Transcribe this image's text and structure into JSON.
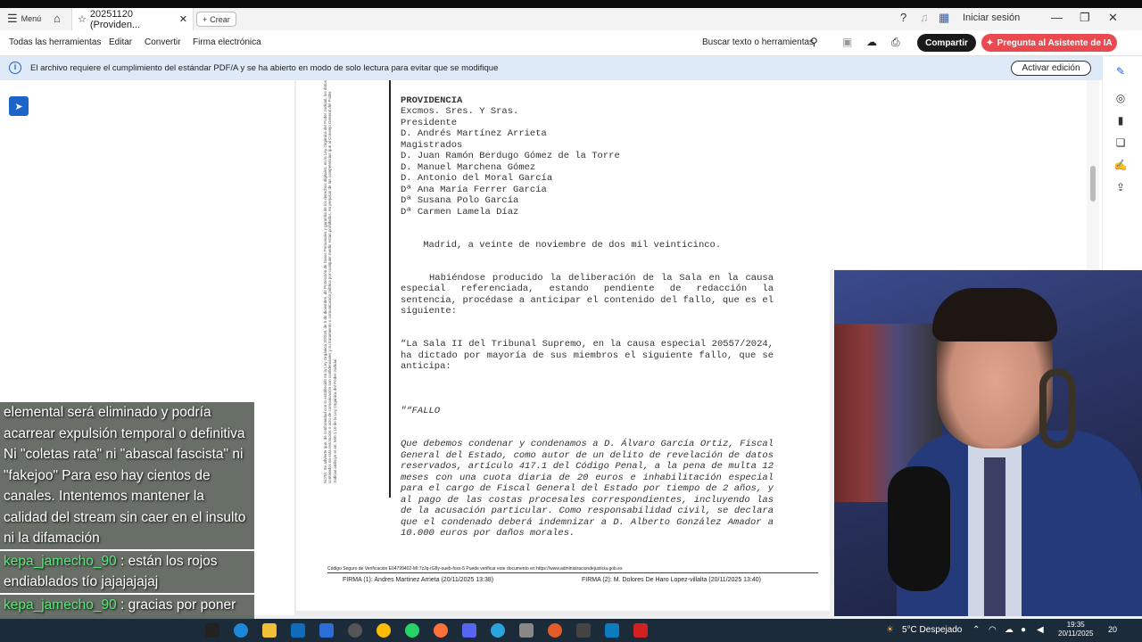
{
  "titlebar": {
    "menu_label": "Menú",
    "tab_title": "20251120 (Providen...",
    "new_tab_label": "Crear",
    "signin_label": "Iniciar sesión"
  },
  "toolbar": {
    "all_tools": "Todas las herramientas",
    "edit": "Editar",
    "convert": "Convertir",
    "esign": "Firma electrónica",
    "search": "Buscar texto o herramientas",
    "share": "Compartir",
    "ai_assistant": "Pregunta al Asistente de IA"
  },
  "banner": {
    "message": "El archivo requiere el cumplimiento del estándar PDF/A y se ha abierto en modo de solo lectura para evitar que se modifique",
    "enable_edit": "Activar edición"
  },
  "document": {
    "side_note": "NOTA: Se advierte que, de conformidad con lo establecido en la Ley Orgánica 3/2018, de 5 de diciembre, de Protección de Datos Personales y garantía de los derechos digitales, en la Ley Orgánica del Poder Judicial, los datos contenidos en esta resolución o acto de comunicación son confidenciales y su tratamiento o comunicación pública por cualquier medio están prohibidos, en perjuicio de las competencias que al Consejo General del Poder Judicial atribuye el art. 560.1.10 de la Ley Orgánica del Poder Judicial",
    "header_lines": [
      "PROVIDENCIA",
      "Excmos. Sres. Y Sras.",
      "Presidente",
      "D. Andrés Martínez Arrieta",
      "Magistrados",
      "D. Juan Ramón Berdugo Gómez de la Torre",
      "D. Manuel Marchena Gómez",
      "D. Antonio del Moral García",
      "Dª Ana María Ferrer García",
      "Dª Susana Polo García",
      "Dª Carmen Lamela Díaz"
    ],
    "place_date": "    Madrid, a veinte de noviembre de dos mil veinticinco.",
    "para1": "Habiéndose producido la deliberación de la Sala en la causa especial referenciada, estando pendiente de redacción la sentencia, procédase a anticipar el contenido del fallo, que es el siguiente:",
    "para2": "“La Sala II del Tribunal Supremo, en la causa especial 20557/2024, ha dictado por mayoría de sus miembros el siguiente fallo, que se anticipa:",
    "fallo_title": "\"“FALLO",
    "fallo_text": "Que debemos condenar y condenamos a D. Álvaro García Ortiz, Fiscal General del Estado, como autor de un delito de revelación de datos reservados, artículo 417.1 del Código Penal, a la pena de multa 12 meses con una cuota diaria de 20 euros e inhabilitación especial para el cargo de Fiscal General del Estado por tiempo de 2 años, y al pago de las costas procesales correspondientes, incluyendo las de la acusación particular. Como responsabilidad civil, se declara que el condenado deberá indemnizar a D. Alberto González Amador a 10.000 euros por daños morales.",
    "footer_code": "Código Seguro de Verificación E04799402-MI:7zJq-rG8y-oueb-foxs-5      Puede verificar este documento en https://www.administraciondejusticia.gob.es",
    "firma1": "FIRMA (1):  Andres Martinez Arrieta (20/11/2025 13:38)",
    "firma2": "FIRMA (2):  M. Dolores De Haro Lopez-villalta (20/11/2025 13:40)"
  },
  "chat": {
    "message1": "elemental será eliminado y podría acarrear expulsión temporal o definitiva Ni \"coletas rata\" ni \"abascal fascista\" ni \"fakejoo\" Para eso hay cientos de canales. Intentemos mantener la calidad del stream sin caer en el insulto ni la difamación",
    "user2": "kepa_jamecho_90",
    "message2": ": están los rojos endiablados tío jajajajajaj",
    "user3": "kepa_jamecho_90",
    "message3": ": gracias por poner criterio don Pablo"
  },
  "taskbar": {
    "weather": "5°C  Despejado",
    "time": "19:35",
    "date": "20/11/2025",
    "notifications": "20"
  },
  "colors": {
    "accent_blue": "#1d64c8",
    "ai_button": "#e9494f",
    "banner_bg": "#dfeaf8",
    "chat_user": "#58e87a"
  }
}
